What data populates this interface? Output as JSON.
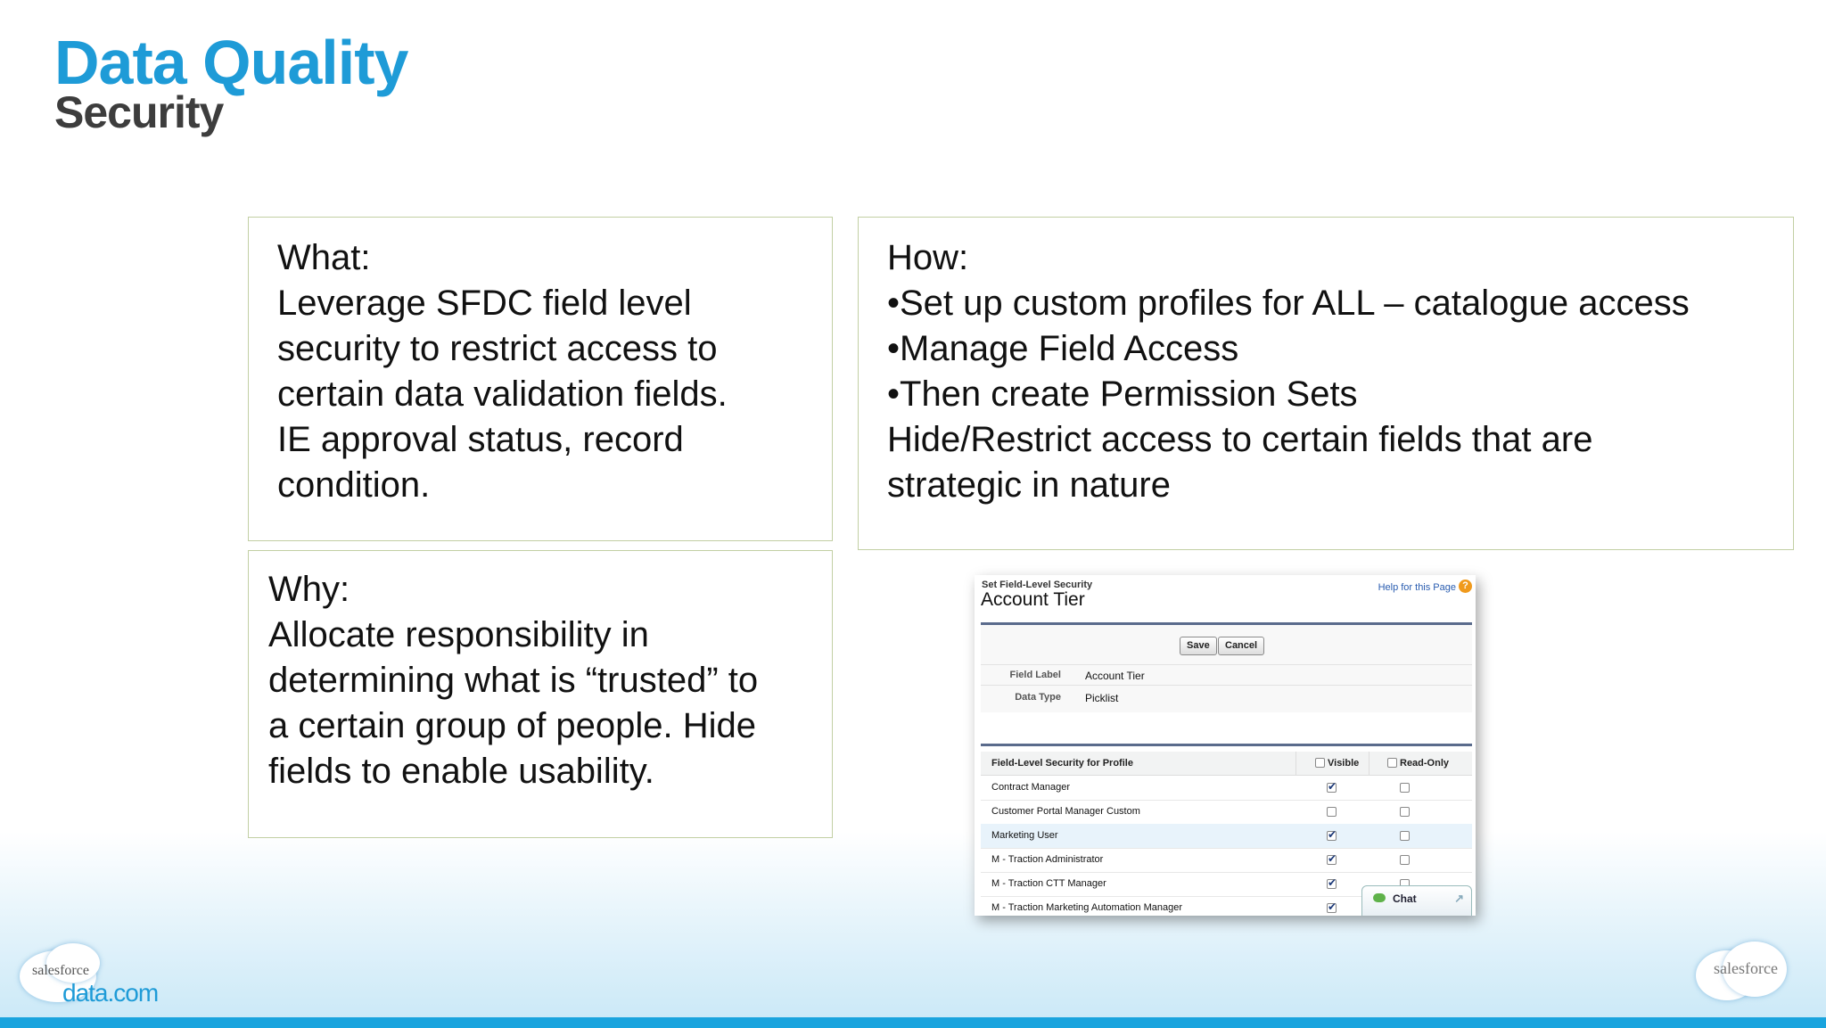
{
  "slide": {
    "title": "Data Quality",
    "subtitle": "Security",
    "what": {
      "lines": [
        "What:",
        "Leverage SFDC field level",
        "security to restrict access to",
        "certain data validation fields.",
        "IE approval status, record",
        "condition."
      ]
    },
    "how": {
      "lines": [
        "How:",
        "•Set up custom profiles for ALL – catalogue access",
        "•Manage Field Access",
        "•Then create Permission Sets",
        "Hide/Restrict access to certain fields that are",
        "strategic in nature"
      ]
    },
    "why": {
      "lines": [
        "Why:",
        "Allocate responsibility in",
        "determining what is “trusted” to",
        "a certain group of people.  Hide",
        "fields to enable usability."
      ]
    }
  },
  "screenshot": {
    "breadcrumb": "Set Field-Level Security",
    "record_title": "Account Tier",
    "help_link": "Help for this Page",
    "help_icon": "help-icon",
    "save_label": "Save",
    "cancel_label": "Cancel",
    "field_label_key": "Field Label",
    "field_label_value": "Account Tier",
    "data_type_key": "Data Type",
    "data_type_value": "Picklist",
    "table": {
      "headers": [
        "Field-Level Security for Profile",
        "Visible",
        "Read-Only"
      ],
      "rows": [
        {
          "profile": "Contract Manager",
          "visible": true,
          "read_only": false
        },
        {
          "profile": "Customer Portal Manager Custom",
          "visible": false,
          "read_only": false
        },
        {
          "profile": "Marketing User",
          "visible": true,
          "read_only": false
        },
        {
          "profile": "M - Traction Administrator",
          "visible": true,
          "read_only": false
        },
        {
          "profile": "M - Traction CTT Manager",
          "visible": true,
          "read_only": false
        },
        {
          "profile": "M - Traction Marketing Automation Manager",
          "visible": true,
          "read_only": false
        }
      ]
    },
    "chat_label": "Chat"
  },
  "logos": {
    "left_top": "salesforce",
    "left_bottom": "data.com",
    "right": "salesforce"
  },
  "colors": {
    "title_blue": "#1e9bd7",
    "box_border": "#c2cfa3",
    "bottom_bar": "#1aa4de"
  }
}
